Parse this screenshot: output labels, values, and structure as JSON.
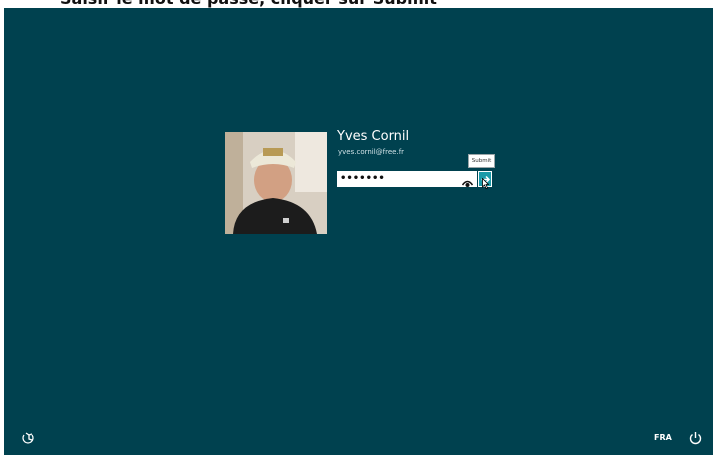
{
  "header": {
    "caption": "Saisir le mot de passe, cliquer sur Submit"
  },
  "user": {
    "name": "Yves Cornil",
    "email": "yves.cornil@free.fr"
  },
  "password": {
    "value": "•••••••"
  },
  "submit": {
    "tooltip": "Submit"
  },
  "footer": {
    "language": "FRA"
  },
  "icons": {
    "reveal": "eye-icon",
    "submit": "arrow-right-icon",
    "ease_of_access": "ease-of-access-icon",
    "power": "power-icon"
  },
  "colors": {
    "background": "#00414f",
    "accent": "#1b9aa8"
  }
}
